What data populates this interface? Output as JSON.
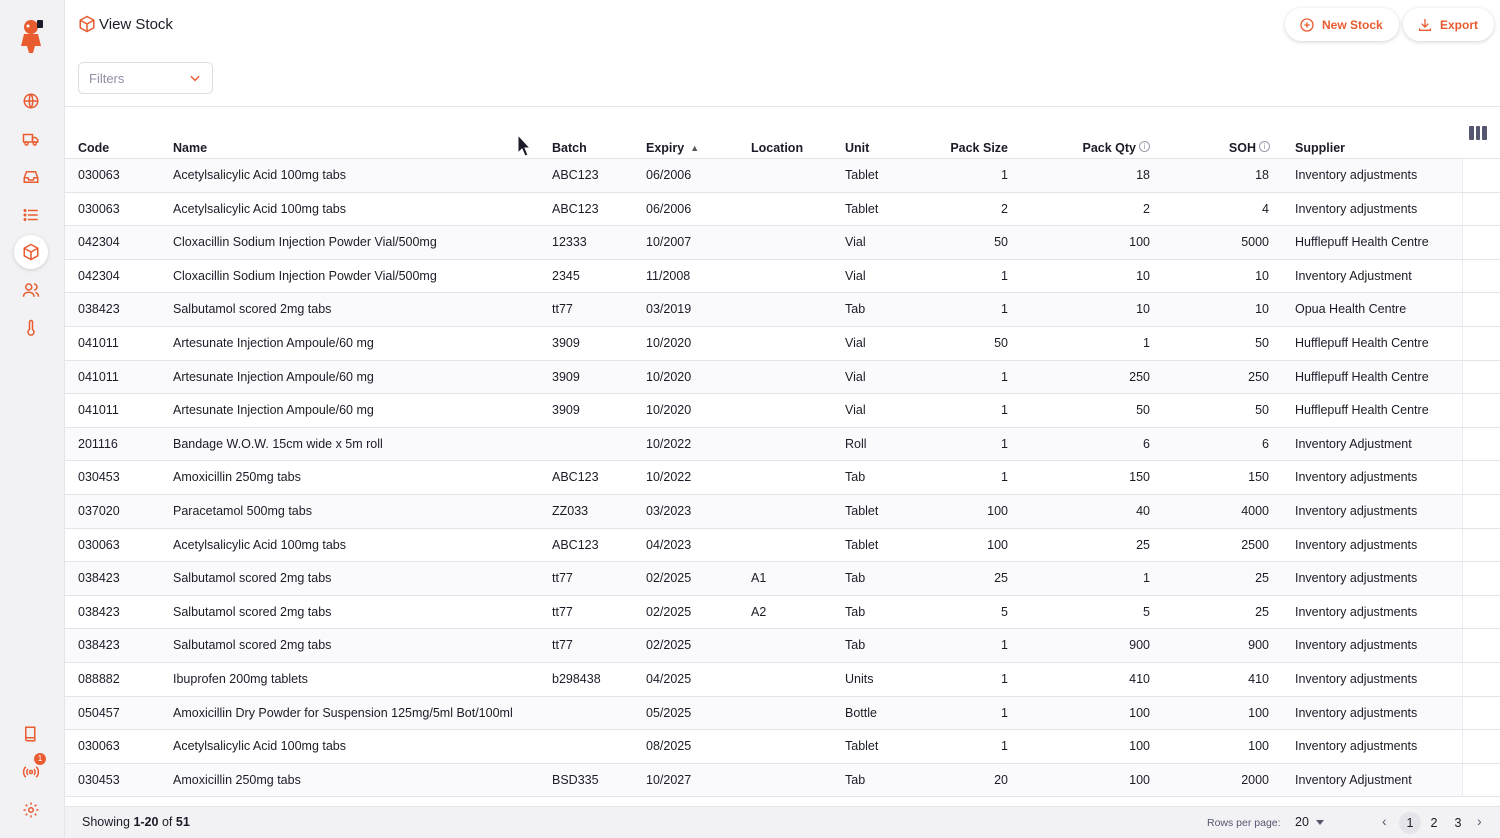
{
  "header": {
    "title": "View Stock",
    "new_stock_label": "New Stock",
    "export_label": "Export",
    "filters_placeholder": "Filters"
  },
  "sidebar": {
    "items": [
      "globe-icon",
      "truck-icon",
      "inbox-icon",
      "list-icon",
      "cube-icon",
      "users-icon",
      "thermometer-icon"
    ],
    "active": "cube-icon",
    "bottom": [
      "book-icon",
      "broadcast-icon",
      "gear-icon"
    ],
    "notification_count": "1"
  },
  "table": {
    "columns": {
      "code": "Code",
      "name": "Name",
      "batch": "Batch",
      "expiry": "Expiry",
      "location": "Location",
      "unit": "Unit",
      "pack_size": "Pack Size",
      "pack_qty": "Pack Qty",
      "soh": "SOH",
      "supplier": "Supplier"
    },
    "sort": {
      "column": "expiry",
      "direction": "ascending"
    },
    "rows": [
      {
        "code": "030063",
        "name": "Acetylsalicylic Acid 100mg tabs",
        "batch": "ABC123",
        "expiry": "06/2006",
        "location": "",
        "unit": "Tablet",
        "pack_size": "1",
        "pack_qty": "18",
        "soh": "18",
        "supplier": "Inventory adjustments"
      },
      {
        "code": "030063",
        "name": "Acetylsalicylic Acid 100mg tabs",
        "batch": "ABC123",
        "expiry": "06/2006",
        "location": "",
        "unit": "Tablet",
        "pack_size": "2",
        "pack_qty": "2",
        "soh": "4",
        "supplier": "Inventory adjustments"
      },
      {
        "code": "042304",
        "name": "Cloxacillin Sodium Injection Powder Vial/500mg",
        "batch": "12333",
        "expiry": "10/2007",
        "location": "",
        "unit": "Vial",
        "pack_size": "50",
        "pack_qty": "100",
        "soh": "5000",
        "supplier": "Hufflepuff Health Centre"
      },
      {
        "code": "042304",
        "name": "Cloxacillin Sodium Injection Powder Vial/500mg",
        "batch": "2345",
        "expiry": "11/2008",
        "location": "",
        "unit": "Vial",
        "pack_size": "1",
        "pack_qty": "10",
        "soh": "10",
        "supplier": "Inventory Adjustment"
      },
      {
        "code": "038423",
        "name": "Salbutamol scored 2mg tabs",
        "batch": "tt77",
        "expiry": "03/2019",
        "location": "",
        "unit": "Tab",
        "pack_size": "1",
        "pack_qty": "10",
        "soh": "10",
        "supplier": "Opua Health Centre"
      },
      {
        "code": "041011",
        "name": "Artesunate Injection Ampoule/60 mg",
        "batch": "3909",
        "expiry": "10/2020",
        "location": "",
        "unit": "Vial",
        "pack_size": "50",
        "pack_qty": "1",
        "soh": "50",
        "supplier": "Hufflepuff Health Centre"
      },
      {
        "code": "041011",
        "name": "Artesunate Injection Ampoule/60 mg",
        "batch": "3909",
        "expiry": "10/2020",
        "location": "",
        "unit": "Vial",
        "pack_size": "1",
        "pack_qty": "250",
        "soh": "250",
        "supplier": "Hufflepuff Health Centre"
      },
      {
        "code": "041011",
        "name": "Artesunate Injection Ampoule/60 mg",
        "batch": "3909",
        "expiry": "10/2020",
        "location": "",
        "unit": "Vial",
        "pack_size": "1",
        "pack_qty": "50",
        "soh": "50",
        "supplier": "Hufflepuff Health Centre"
      },
      {
        "code": "201116",
        "name": "Bandage W.O.W. 15cm wide x 5m roll",
        "batch": "",
        "expiry": "10/2022",
        "location": "",
        "unit": "Roll",
        "pack_size": "1",
        "pack_qty": "6",
        "soh": "6",
        "supplier": "Inventory Adjustment"
      },
      {
        "code": "030453",
        "name": "Amoxicillin 250mg tabs",
        "batch": "ABC123",
        "expiry": "10/2022",
        "location": "",
        "unit": "Tab",
        "pack_size": "1",
        "pack_qty": "150",
        "soh": "150",
        "supplier": "Inventory adjustments"
      },
      {
        "code": "037020",
        "name": "Paracetamol 500mg tabs",
        "batch": "ZZ033",
        "expiry": "03/2023",
        "location": "",
        "unit": "Tablet",
        "pack_size": "100",
        "pack_qty": "40",
        "soh": "4000",
        "supplier": "Inventory adjustments"
      },
      {
        "code": "030063",
        "name": "Acetylsalicylic Acid 100mg tabs",
        "batch": "ABC123",
        "expiry": "04/2023",
        "location": "",
        "unit": "Tablet",
        "pack_size": "100",
        "pack_qty": "25",
        "soh": "2500",
        "supplier": "Inventory adjustments"
      },
      {
        "code": "038423",
        "name": "Salbutamol scored 2mg tabs",
        "batch": "tt77",
        "expiry": "02/2025",
        "location": "A1",
        "unit": "Tab",
        "pack_size": "25",
        "pack_qty": "1",
        "soh": "25",
        "supplier": "Inventory adjustments"
      },
      {
        "code": "038423",
        "name": "Salbutamol scored 2mg tabs",
        "batch": "tt77",
        "expiry": "02/2025",
        "location": "A2",
        "unit": "Tab",
        "pack_size": "5",
        "pack_qty": "5",
        "soh": "25",
        "supplier": "Inventory adjustments"
      },
      {
        "code": "038423",
        "name": "Salbutamol scored 2mg tabs",
        "batch": "tt77",
        "expiry": "02/2025",
        "location": "",
        "unit": "Tab",
        "pack_size": "1",
        "pack_qty": "900",
        "soh": "900",
        "supplier": "Inventory adjustments"
      },
      {
        "code": "088882",
        "name": "Ibuprofen 200mg tablets",
        "batch": "b298438",
        "expiry": "04/2025",
        "location": "",
        "unit": "Units",
        "pack_size": "1",
        "pack_qty": "410",
        "soh": "410",
        "supplier": "Inventory adjustments"
      },
      {
        "code": "050457",
        "name": "Amoxicillin Dry Powder for Suspension 125mg/5ml Bot/100ml",
        "batch": "",
        "expiry": "05/2025",
        "location": "",
        "unit": "Bottle",
        "pack_size": "1",
        "pack_qty": "100",
        "soh": "100",
        "supplier": "Inventory adjustments"
      },
      {
        "code": "030063",
        "name": "Acetylsalicylic Acid 100mg tabs",
        "batch": "",
        "expiry": "08/2025",
        "location": "",
        "unit": "Tablet",
        "pack_size": "1",
        "pack_qty": "100",
        "soh": "100",
        "supplier": "Inventory adjustments"
      },
      {
        "code": "030453",
        "name": "Amoxicillin 250mg tabs",
        "batch": "BSD335",
        "expiry": "10/2027",
        "location": "",
        "unit": "Tab",
        "pack_size": "20",
        "pack_qty": "100",
        "soh": "2000",
        "supplier": "Inventory Adjustment"
      }
    ]
  },
  "footer": {
    "showing_prefix": "Showing",
    "showing_range": "1-20",
    "showing_of": "of",
    "showing_total": "51",
    "rows_per_page_label": "Rows per page:",
    "rows_per_page_value": "20",
    "pages": [
      "1",
      "2",
      "3"
    ],
    "current_page": "1"
  },
  "colors": {
    "accent": "#e95c30",
    "sidebar_bg": "#f2f2f5",
    "border": "#e4e4ea"
  }
}
